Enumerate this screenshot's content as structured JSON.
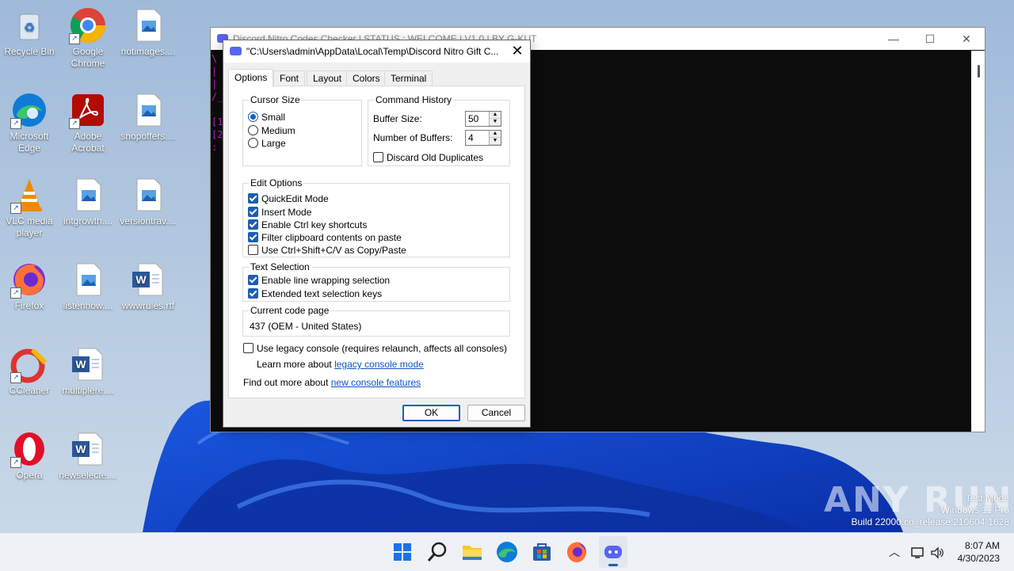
{
  "desktop": {
    "icons": [
      {
        "label": "Recycle Bin",
        "icon": "recycle-bin-icon"
      },
      {
        "label": "Google Chrome",
        "icon": "chrome-icon"
      },
      {
        "label": "notimages....",
        "icon": "image-file-icon"
      },
      {
        "label": "Microsoft Edge",
        "icon": "edge-icon"
      },
      {
        "label": "Adobe Acrobat",
        "icon": "acrobat-icon"
      },
      {
        "label": "shopoffers....",
        "icon": "image-file-icon"
      },
      {
        "label": "VLC media player",
        "icon": "vlc-icon"
      },
      {
        "label": "intgrowth....",
        "icon": "image-file-icon"
      },
      {
        "label": "versiontrav....",
        "icon": "image-file-icon"
      },
      {
        "label": "Firefox",
        "icon": "firefox-icon"
      },
      {
        "label": "listenhow....",
        "icon": "image-file-icon"
      },
      {
        "label": "wwwrules.rtf",
        "icon": "word-doc-icon"
      },
      {
        "label": "CCleaner",
        "icon": "ccleaner-icon"
      },
      {
        "label": "multiplere....",
        "icon": "word-doc-icon"
      },
      {
        "label": "Opera",
        "icon": "opera-icon"
      },
      {
        "label": "newselecte....",
        "icon": "word-doc-icon"
      }
    ]
  },
  "console": {
    "title": "Discord Nitro Codes Checker | STATUS : WELCOME | V1.0 | BY G-KUT",
    "lines": [
      "\\",
      "|",
      "|",
      "/_",
      "",
      "[1",
      "[2",
      ":"
    ]
  },
  "dialog": {
    "title": "\"C:\\Users\\admin\\AppData\\Local\\Temp\\Discord Nitro Gift C...",
    "close": "✕",
    "tabs": [
      "Options",
      "Font",
      "Layout",
      "Colors",
      "Terminal"
    ],
    "cursor_size": {
      "title": "Cursor Size",
      "options": [
        "Small",
        "Medium",
        "Large"
      ],
      "selected": "Small"
    },
    "command_history": {
      "title": "Command History",
      "buffer_size_label": "Buffer Size:",
      "buffer_size": "50",
      "num_buffers_label": "Number of Buffers:",
      "num_buffers": "4",
      "discard_label": "Discard Old Duplicates"
    },
    "edit_options": {
      "title": "Edit Options",
      "items": [
        {
          "label": "QuickEdit Mode",
          "checked": true
        },
        {
          "label": "Insert Mode",
          "checked": true
        },
        {
          "label": "Enable Ctrl key shortcuts",
          "checked": true
        },
        {
          "label": "Filter clipboard contents on paste",
          "checked": true
        },
        {
          "label": "Use Ctrl+Shift+C/V as Copy/Paste",
          "checked": false
        }
      ]
    },
    "text_selection": {
      "title": "Text Selection",
      "items": [
        {
          "label": "Enable line wrapping selection",
          "checked": true
        },
        {
          "label": "Extended text selection keys",
          "checked": true
        }
      ]
    },
    "code_page": {
      "title": "Current code page",
      "value": "437   (OEM - United States)"
    },
    "legacy_label": "Use legacy console (requires relaunch, affects all consoles)",
    "learn_more_prefix": "Learn more about ",
    "learn_more_link": "legacy console mode",
    "find_out_prefix": "Find out more about ",
    "find_out_link": "new console features",
    "ok": "OK",
    "cancel": "Cancel"
  },
  "watermark": {
    "brand": "ANY RUN",
    "line1": "Test Mode",
    "line2": "Windows 11 Pro",
    "line3": "Build 22000.co_release.210604-1628"
  },
  "taskbar": {
    "apps": [
      "start-icon",
      "search-icon",
      "file-explorer-icon",
      "edge-icon",
      "store-icon",
      "firefox-icon",
      "discord-icon"
    ],
    "time": "8:07 AM",
    "date": "4/30/2023"
  },
  "colors": {
    "accent": "#1a5fb4",
    "console_text": "#c51bc5",
    "link": "#0b55c4"
  }
}
